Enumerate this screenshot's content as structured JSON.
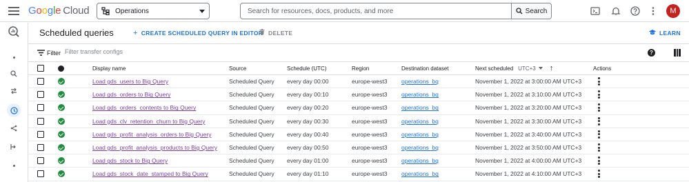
{
  "topbar": {
    "logo": {
      "g": "G",
      "o1": "o",
      "o2": "o",
      "g2": "g",
      "l": "l",
      "e": "e",
      "cloud": "Cloud"
    },
    "project_selector": {
      "label": "Operations",
      "icon": "project-tree-icon"
    },
    "search": {
      "placeholder": "Search for resources, docs, products, and more",
      "button_label": "Search"
    },
    "icons": [
      "cloud-shell-icon",
      "notifications-icon",
      "help-icon",
      "more-vert-icon"
    ],
    "avatar_initial": "M"
  },
  "rail": {
    "items": [
      "bigquery-logo-icon",
      "dot-icon",
      "search-icon",
      "transfers-icon",
      "scheduled-queries-icon",
      "analytics-hub-icon",
      "dataflow-icon",
      "dot-icon"
    ],
    "active_index": 4
  },
  "page": {
    "title": "Scheduled queries",
    "create_label": "CREATE SCHEDULED QUERY IN EDITOR",
    "delete_label": "DELETE",
    "learn_label": "LEARN"
  },
  "filter": {
    "label": "Filter",
    "placeholder": "Filter transfer configs"
  },
  "table": {
    "columns": {
      "display_name": "Display name",
      "source": "Source",
      "schedule": "Schedule (UTC)",
      "region": "Region",
      "destination": "Destination dataset",
      "next_scheduled": "Next scheduled",
      "timezone": "UTC+3",
      "actions": "Actions"
    },
    "rows": [
      {
        "name": "Load gds_users to Big Query",
        "source": "Scheduled Query",
        "schedule": "every day 00:00",
        "region": "europe-west3",
        "dataset": "operations_bq",
        "next": "November 1, 2022 at 3:00:00 AM UTC+3"
      },
      {
        "name": "Load gds_orders to Big Query",
        "source": "Scheduled Query",
        "schedule": "every day 00:10",
        "region": "europe-west3",
        "dataset": "operations_bq",
        "next": "November 1, 2022 at 3:10:00 AM UTC+3"
      },
      {
        "name": "Load gds_orders_contents to Big Query",
        "source": "Scheduled Query",
        "schedule": "every day 00:20",
        "region": "europe-west3",
        "dataset": "operations_bq",
        "next": "November 1, 2022 at 3:20:00 AM UTC+3"
      },
      {
        "name": "Load gds_clv_retention_churn to Big Query",
        "source": "Scheduled Query",
        "schedule": "every day 00:30",
        "region": "europe-west3",
        "dataset": "operations_bq",
        "next": "November 1, 2022 at 3:30:00 AM UTC+3"
      },
      {
        "name": "Load gds_profit_analysis_orders to Big Query",
        "source": "Scheduled Query",
        "schedule": "every day 00:40",
        "region": "europe-west3",
        "dataset": "operations_bq",
        "next": "November 1, 2022 at 3:40:00 AM UTC+3"
      },
      {
        "name": "Load gds_profit_analysis_products to Big Query",
        "source": "Scheduled Query",
        "schedule": "every day 00:50",
        "region": "europe-west3",
        "dataset": "operations_bq",
        "next": "November 1, 2022 at 3:50:00 AM UTC+3"
      },
      {
        "name": "Load gds_stock to Big Query",
        "source": "Scheduled Query",
        "schedule": "every day 01:00",
        "region": "europe-west3",
        "dataset": "operations_bq",
        "next": "November 1, 2022 at 4:00:00 AM UTC+3"
      },
      {
        "name": "Load gds_stock_date_stamped to Big Query",
        "source": "Scheduled Query",
        "schedule": "every day 01:10",
        "region": "europe-west3",
        "dataset": "operations_bq",
        "next": "November 1, 2022 at 4:10:00 AM UTC+3"
      }
    ]
  },
  "colors": {
    "accent": "#1a73e8",
    "success": "#1e8e3e",
    "visited_link": "#7b3da1",
    "avatar": "#c5221f"
  }
}
